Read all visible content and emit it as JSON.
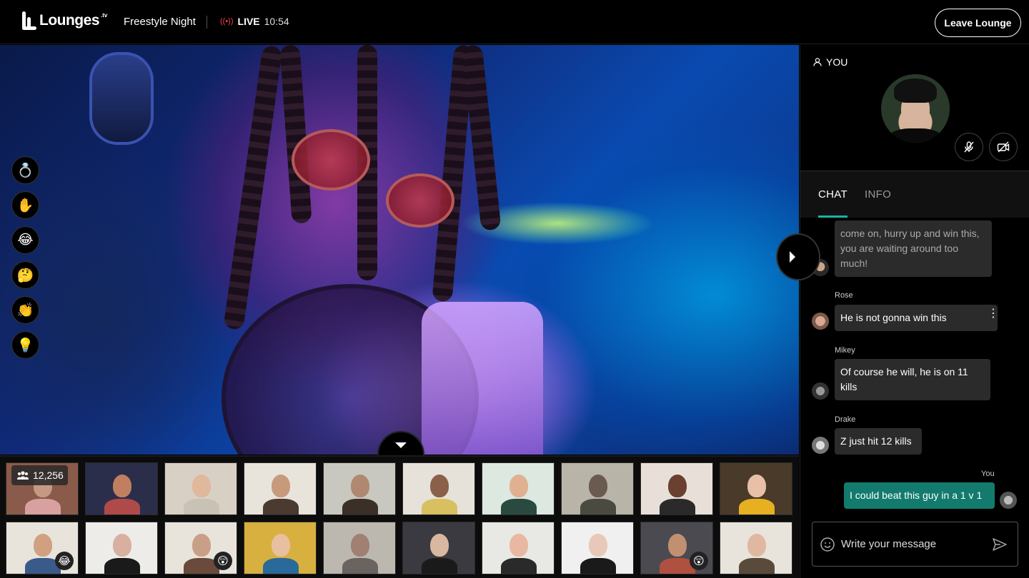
{
  "header": {
    "logo_text": "Lounges",
    "logo_tld": ".tv",
    "room_title": "Freestyle Night",
    "live_label": "LIVE",
    "live_time": "10:54",
    "leave_label": "Leave Lounge"
  },
  "reactions": [
    {
      "name": "rings-reaction",
      "glyph": "💍"
    },
    {
      "name": "raise-hand-reaction",
      "glyph": "✋"
    },
    {
      "name": "laugh-reaction",
      "glyph": "😂"
    },
    {
      "name": "thinking-reaction",
      "glyph": "🤔"
    },
    {
      "name": "clap-reaction",
      "glyph": "👏"
    },
    {
      "name": "idea-reaction",
      "glyph": "💡"
    }
  ],
  "participants": {
    "viewer_count": "12,256",
    "badges": {
      "row2_col1": "😂",
      "row2_col3": "😲",
      "row2_col9": "😲"
    }
  },
  "self": {
    "label": "YOU"
  },
  "tabs": {
    "chat": "CHAT",
    "info": "INFO"
  },
  "chat": {
    "messages": [
      {
        "name": "",
        "text": "come on, hurry up and win this, you are waiting around too much!"
      },
      {
        "name": "Rose",
        "text": "He is not gonna win this"
      },
      {
        "name": "Mikey",
        "text": "Of course he will, he is on 11 kills"
      },
      {
        "name": "Drake",
        "text": "Z just hit 12 kills"
      },
      {
        "name": "You",
        "text": "I could beat this guy in a 1 v 1"
      }
    ]
  },
  "composer": {
    "placeholder": "Write your message"
  },
  "colors": {
    "accent": "#17b3a8",
    "own_bubble": "#137a6e",
    "live": "#ff3b4a"
  }
}
